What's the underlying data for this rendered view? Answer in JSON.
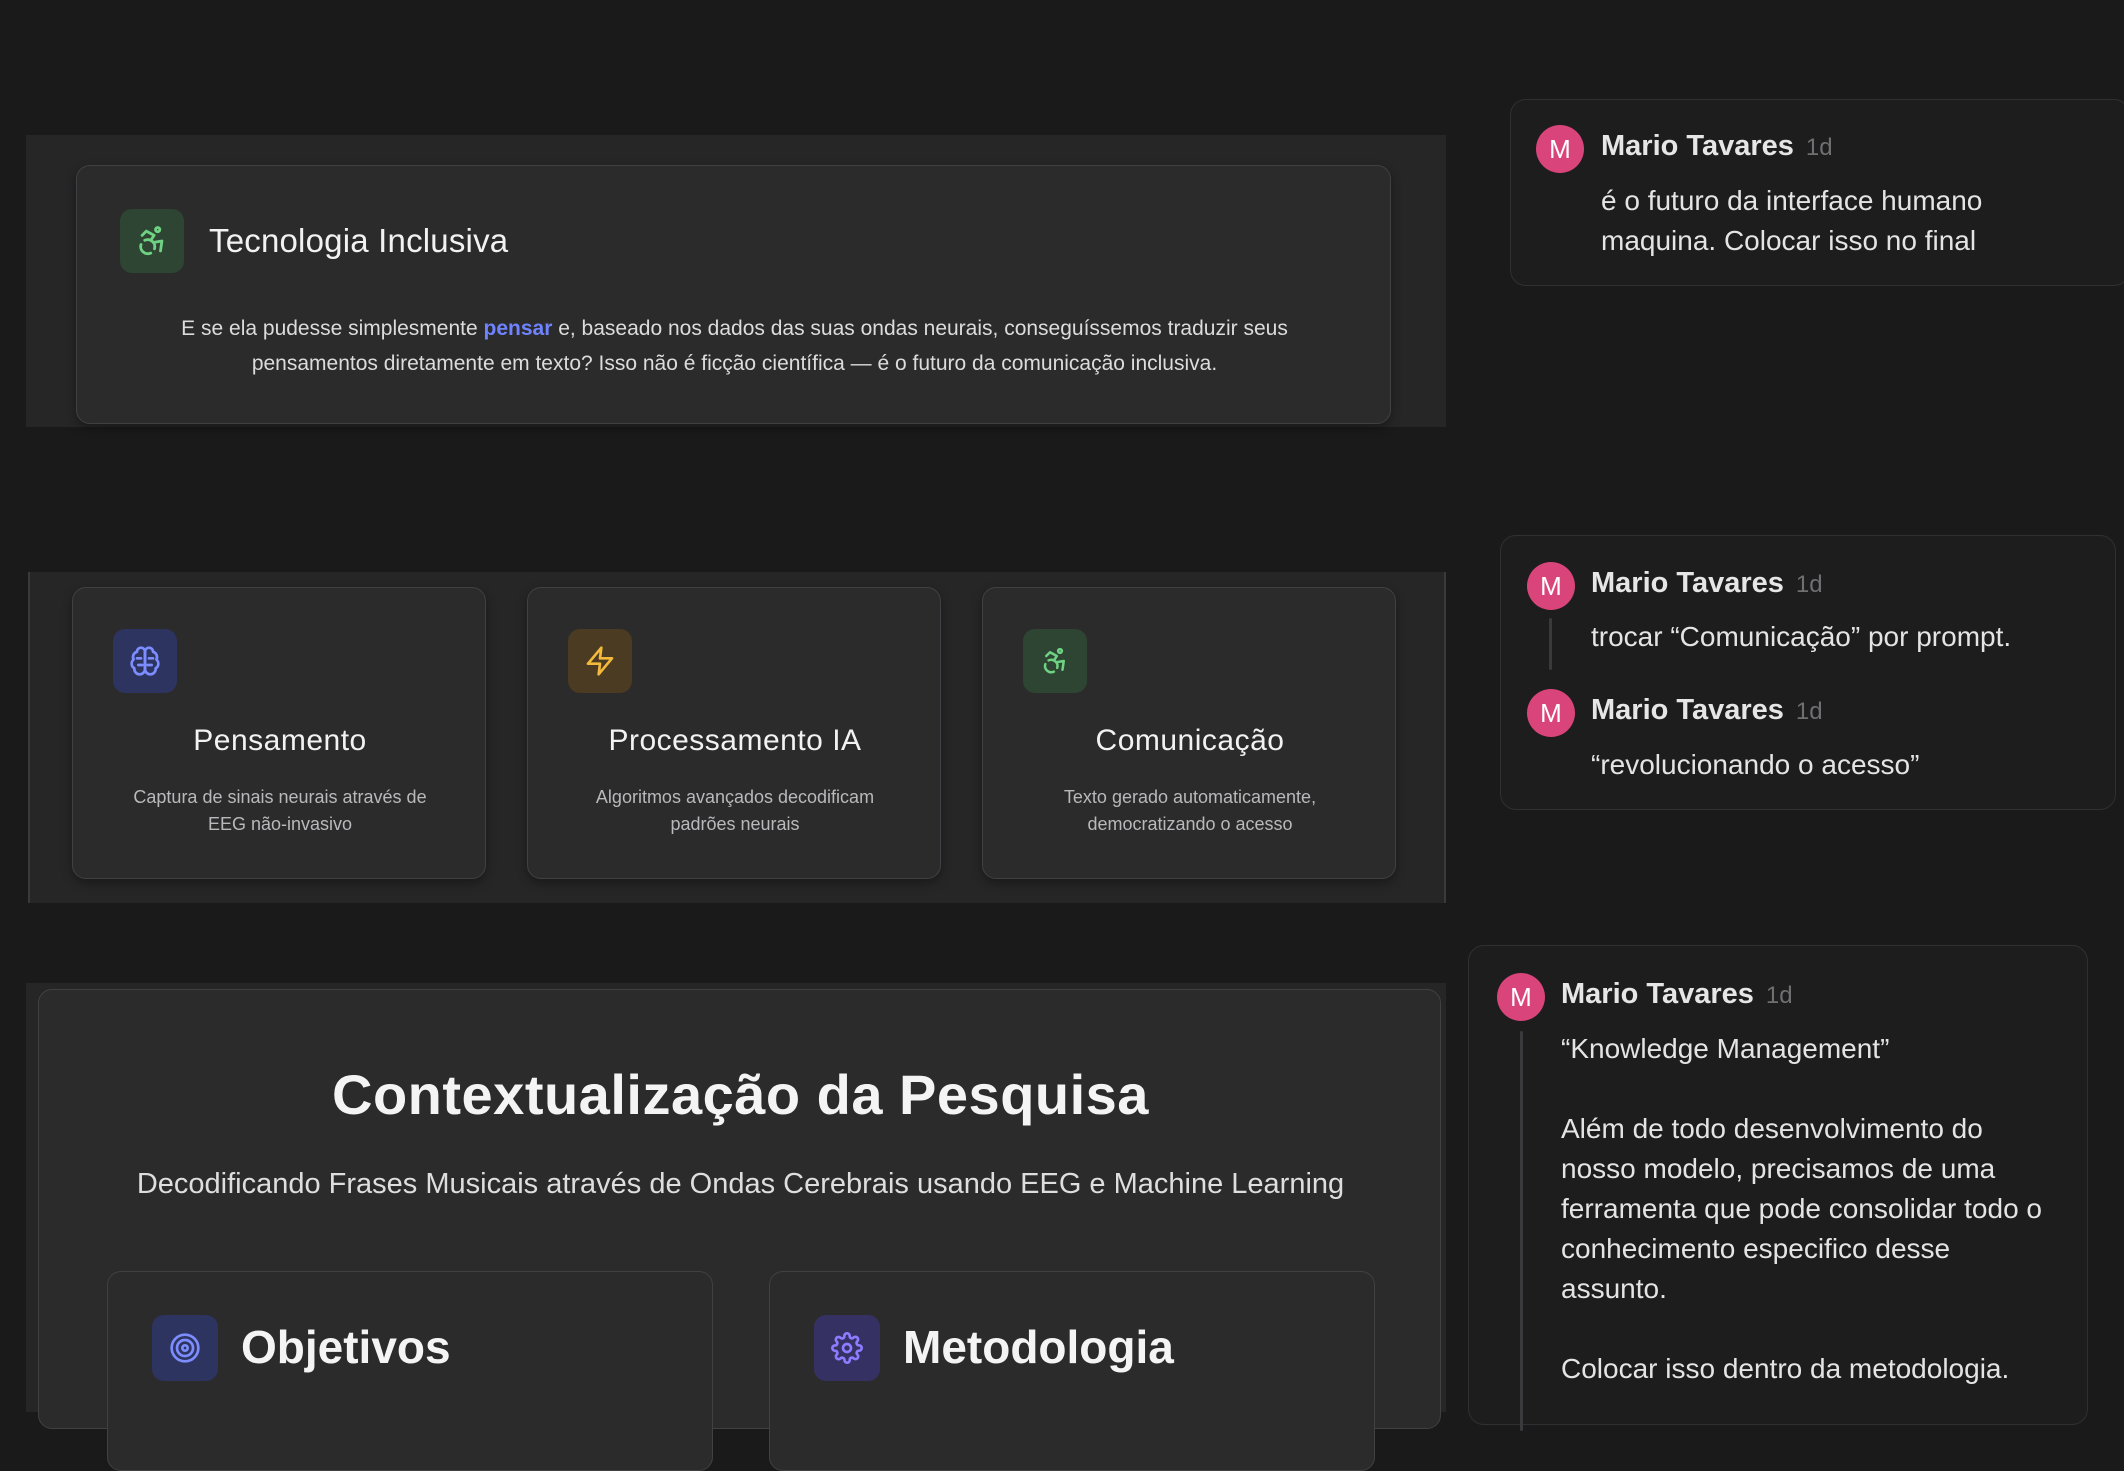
{
  "intro": {
    "title": "Tecnologia Inclusiva",
    "text_before": "E se ela pudesse simplesmente ",
    "highlight": "pensar",
    "text_after": " e, baseado nos dados das suas ondas neurais, conseguíssemos traduzir seus pensamentos diretamente em texto? Isso não é ficção científica — é o futuro da comunicação inclusiva.",
    "icon": "accessibility-icon"
  },
  "features": [
    {
      "title": "Pensamento",
      "desc": "Captura de sinais neurais através de EEG não-invasivo",
      "icon": "brain-icon",
      "color": "#7c8dff"
    },
    {
      "title": "Processamento IA",
      "desc": "Algoritmos avançados decodificam padrões neurais",
      "icon": "lightning-icon",
      "color": "#f2b93a"
    },
    {
      "title": "Comunicação",
      "desc": "Texto gerado automaticamente, democratizando o acesso",
      "icon": "accessibility-icon",
      "color": "#6fd283"
    }
  ],
  "context": {
    "title": "Contextualização da Pesquisa",
    "subtitle": "Decodificando Frases Musicais através de Ondas Cerebrais usando EEG e Machine Learning",
    "cards": [
      {
        "title": "Objetivos",
        "icon": "target-icon"
      },
      {
        "title": "Metodologia",
        "icon": "gear-icon"
      }
    ]
  },
  "comments": [
    {
      "avatar": "M",
      "author": "Mario Tavares",
      "time": "1d",
      "text": "é o futuro da interface humano maquina. Colocar isso no final"
    },
    {
      "avatar": "M",
      "author": "Mario Tavares",
      "time": "1d",
      "text": "trocar “Comunicação” por prompt."
    },
    {
      "avatar": "M",
      "author": "Mario Tavares",
      "time": "1d",
      "text": "“revolucionando o acesso”"
    },
    {
      "avatar": "M",
      "author": "Mario Tavares",
      "time": "1d",
      "text": "“Knowledge Management”\n\nAlém de todo desenvolvimento do nosso modelo, precisamos de uma ferramenta que pode consolidar todo o conhecimento especifico desse assunto.\n\nColocar isso dentro da metodologia."
    }
  ],
  "colors": {
    "accent_link": "#6f83ff",
    "avatar": "#d9457a",
    "background": "#1a1a1b"
  }
}
